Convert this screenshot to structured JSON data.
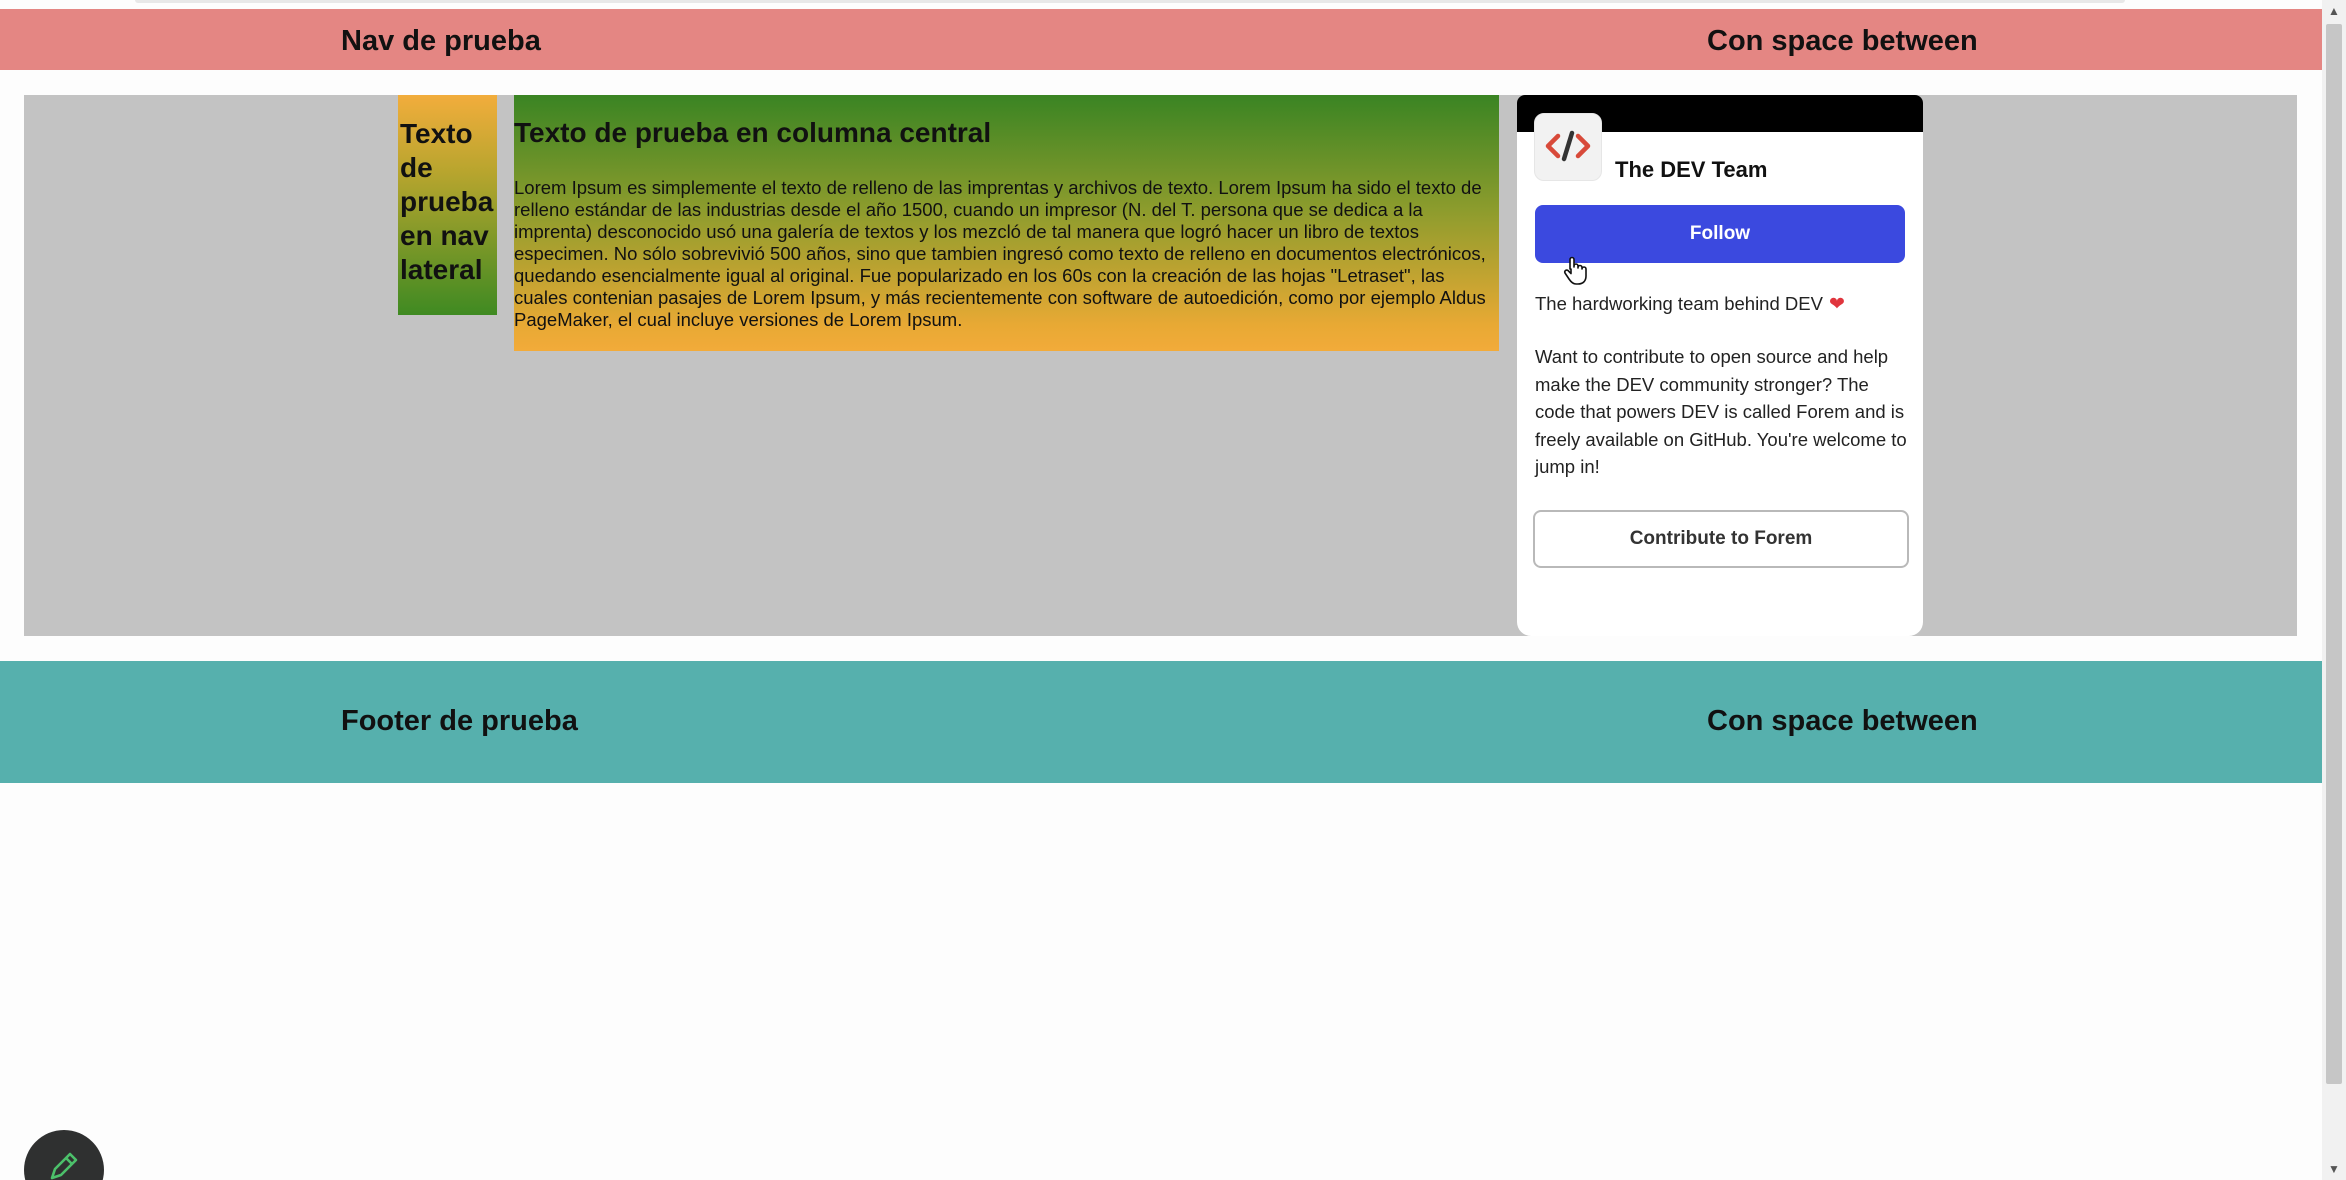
{
  "nav": {
    "title": "Nav de prueba",
    "right": "Con space between"
  },
  "side_nav": {
    "text": "Texto de prueba en nav lateral"
  },
  "center": {
    "heading": "Texto de prueba en columna central",
    "paragraph": "Lorem Ipsum es simplemente el texto de relleno de las imprentas y archivos de texto. Lorem Ipsum ha sido el texto de relleno estándar de las industrias desde el año 1500, cuando un impresor (N. del T. persona que se dedica a la imprenta) desconocido usó una galería de textos y los mezcló de tal manera que logró hacer un libro de textos especimen. No sólo sobrevivió 500 años, sino que tambien ingresó como texto de relleno en documentos electrónicos, quedando esencialmente igual al original. Fue popularizado en los 60s con la creación de las hojas \"Letraset\", las cuales contenian pasajes de Lorem Ipsum, y más recientemente con software de autoedición, como por ejemplo Aldus PageMaker, el cual incluye versiones de Lorem Ipsum."
  },
  "card": {
    "name": "The DEV Team",
    "follow_label": "Follow",
    "tagline": "The hardworking team behind DEV",
    "body": "Want to contribute to open source and help make the DEV community stronger? The code that powers DEV is called Forem and is freely available on GitHub. You're welcome to jump in!",
    "contribute_label": "Contribute to Forem",
    "logo_icon": "code-brackets-icon",
    "accent_color": "#3b49df"
  },
  "footer": {
    "title": "Footer de prueba",
    "right": "Con space between"
  },
  "colors": {
    "nav_bg": "#e48683",
    "footer_bg": "#56b0ad",
    "main_bg": "#c3c3c3"
  }
}
